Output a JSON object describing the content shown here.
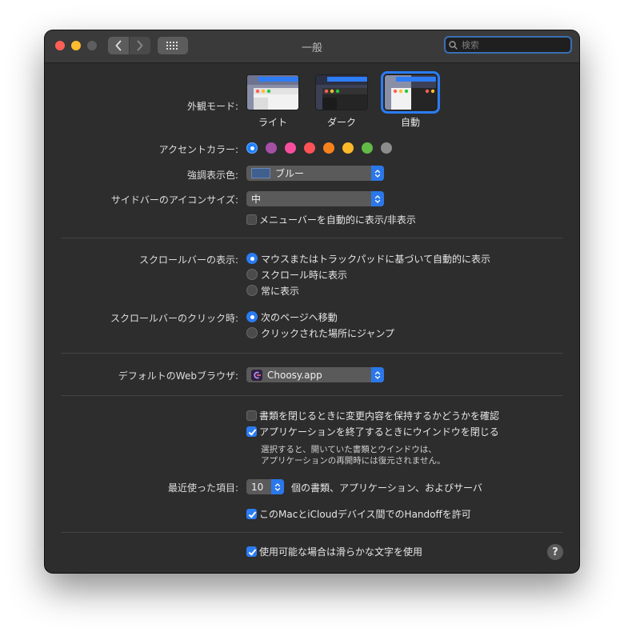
{
  "window": {
    "title": "一般"
  },
  "search": {
    "placeholder": "検索"
  },
  "appearance": {
    "label": "外観モード:",
    "options": [
      {
        "name": "ライト",
        "selected": false
      },
      {
        "name": "ダーク",
        "selected": false
      },
      {
        "name": "自動",
        "selected": true
      }
    ]
  },
  "accent": {
    "label": "アクセントカラー:",
    "colors": [
      "#1e80ff",
      "#a550a7",
      "#f74f9e",
      "#ff5257",
      "#f7821b",
      "#fbb829",
      "#62ba46",
      "#8c8c8c"
    ],
    "selected_index": 0
  },
  "highlight": {
    "label": "強調表示色:",
    "value": "ブルー",
    "swatch": "#3f5f8f"
  },
  "sidebar_icon": {
    "label": "サイドバーのアイコンサイズ:",
    "value": "中"
  },
  "menubar_autohide": {
    "label": "メニューバーを自動的に表示/非表示",
    "checked": false
  },
  "scrollbars": {
    "label": "スクロールバーの表示:",
    "options": [
      {
        "text": "マウスまたはトラックパッドに基づいて自動的に表示",
        "selected": true
      },
      {
        "text": "スクロール時に表示",
        "selected": false
      },
      {
        "text": "常に表示",
        "selected": false
      }
    ]
  },
  "scroll_click": {
    "label": "スクロールバーのクリック時:",
    "options": [
      {
        "text": "次のページへ移動",
        "selected": true
      },
      {
        "text": "クリックされた場所にジャンプ",
        "selected": false
      }
    ]
  },
  "browser": {
    "label": "デフォルトのWebブラウザ:",
    "value": "Choosy.app",
    "icon": "choosy-app-icon"
  },
  "documents": {
    "ask_keep_changes": {
      "text": "書類を閉じるときに変更内容を保持するかどうかを確認",
      "checked": false
    },
    "close_windows": {
      "text": "アプリケーションを終了するときにウインドウを閉じる",
      "checked": true
    },
    "note_line1": "選択すると、開いていた書類とウインドウは、",
    "note_line2": "アプリケーションの再開時には復元されません。"
  },
  "recent": {
    "label": "最近使った項目:",
    "value": "10",
    "suffix": "個の書類、アプリケーション、およびサーバ"
  },
  "handoff": {
    "text": "このMacとiCloudデバイス間でのHandoffを許可",
    "checked": true
  },
  "font_smoothing": {
    "text": "使用可能な場合は滑らかな文字を使用",
    "checked": true
  },
  "help": {
    "label": "?"
  },
  "colors": {
    "accent": "#2b7cf3",
    "window_bg": "#2d2d2d",
    "titlebar_bg": "#3a3a3a"
  }
}
